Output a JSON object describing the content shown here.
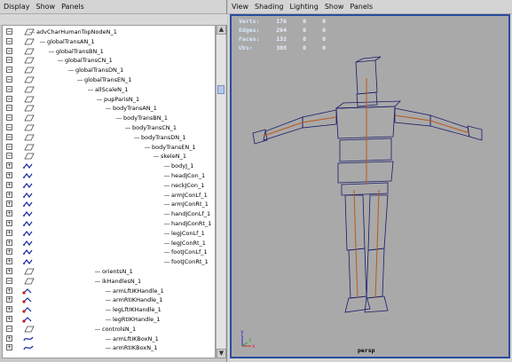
{
  "left_panel": {
    "menu": [
      "Display",
      "Show",
      "Panels"
    ],
    "tree_rows": [
      {
        "label": "advCharHumanTopNodeN_1",
        "exp": "−",
        "icon": "transform-icon"
      },
      {
        "label": "globalTransAN_1",
        "exp": "−",
        "icon": "transform-icon"
      },
      {
        "label": "globalTransBN_1",
        "exp": "−",
        "icon": "transform-icon"
      },
      {
        "label": "globalTransCN_1",
        "exp": "−",
        "icon": "transform-icon"
      },
      {
        "label": "globalTransDN_1",
        "exp": "−",
        "icon": "transform-icon"
      },
      {
        "label": "globalTransEN_1",
        "exp": "−",
        "icon": "transform-icon"
      },
      {
        "label": "allScaleN_1",
        "exp": "−",
        "icon": "transform-icon"
      },
      {
        "label": "pupParisN_1",
        "exp": "−",
        "icon": "transform-icon"
      },
      {
        "label": "bodyTransAN_1",
        "exp": "−",
        "icon": "transform-icon"
      },
      {
        "label": "bodyTransBN_1",
        "exp": "−",
        "icon": "transform-icon"
      },
      {
        "label": "bodyTransCN_1",
        "exp": "−",
        "icon": "transform-icon"
      },
      {
        "label": "bodyTransDN_1",
        "exp": "−",
        "icon": "transform-icon"
      },
      {
        "label": "bodyTransEN_1",
        "exp": "−",
        "icon": "transform-icon"
      },
      {
        "label": "skeleN_1",
        "exp": "−",
        "icon": "transform-icon"
      },
      {
        "label": "bodyJ_1",
        "exp": "+",
        "icon": "joint-icon"
      },
      {
        "label": "headJCon_1",
        "exp": "+",
        "icon": "joint-icon"
      },
      {
        "label": "neckJCon_1",
        "exp": "+",
        "icon": "joint-icon"
      },
      {
        "label": "armJConLf_1",
        "exp": "+",
        "icon": "joint-icon"
      },
      {
        "label": "armJConRt_1",
        "exp": "+",
        "icon": "joint-icon"
      },
      {
        "label": "handJConLf_1",
        "exp": "+",
        "icon": "joint-icon"
      },
      {
        "label": "handJConRt_1",
        "exp": "+",
        "icon": "joint-icon"
      },
      {
        "label": "legJConLf_1",
        "exp": "+",
        "icon": "joint-icon"
      },
      {
        "label": "legJConRt_1",
        "exp": "+",
        "icon": "joint-icon"
      },
      {
        "label": "footJConLf_1",
        "exp": "+",
        "icon": "joint-icon"
      },
      {
        "label": "footJConRt_1",
        "exp": "+",
        "icon": "joint-icon"
      },
      {
        "label": "orientsN_1",
        "exp": "+",
        "icon": "transform-icon"
      },
      {
        "label": "ikHandlesN_1",
        "exp": "−",
        "icon": "transform-icon"
      },
      {
        "label": "armLftIKHandle_1",
        "exp": "+",
        "icon": "ik-handle-icon"
      },
      {
        "label": "armRtIKHandle_1",
        "exp": "+",
        "icon": "ik-handle-icon"
      },
      {
        "label": "legLftIKHandle_1",
        "exp": "+",
        "icon": "ik-handle-icon"
      },
      {
        "label": "legRtIKHandle_1",
        "exp": "+",
        "icon": "ik-handle-icon"
      },
      {
        "label": "controlsN_1",
        "exp": "−",
        "icon": "transform-icon"
      },
      {
        "label": "armLftIKBoxN_1",
        "exp": "+",
        "icon": "curve-icon"
      },
      {
        "label": "armRtIKBoxN_1",
        "exp": "+",
        "icon": "curve-icon"
      }
    ]
  },
  "viewport": {
    "menu": [
      "View",
      "Shading",
      "Lighting",
      "Show",
      "Panels"
    ],
    "hud": [
      {
        "key": "Verts:",
        "v1": "176",
        "v2": "0",
        "v3": "0"
      },
      {
        "key": "Edges:",
        "v1": "264",
        "v2": "0",
        "v3": "0"
      },
      {
        "key": "Faces:",
        "v1": "132",
        "v2": "0",
        "v3": "0"
      },
      {
        "key": "UVs:",
        "v1": "308",
        "v2": "0",
        "v3": "0"
      }
    ],
    "camera": "persp",
    "axes": {
      "x": "x",
      "y": "y",
      "z": "z"
    }
  }
}
